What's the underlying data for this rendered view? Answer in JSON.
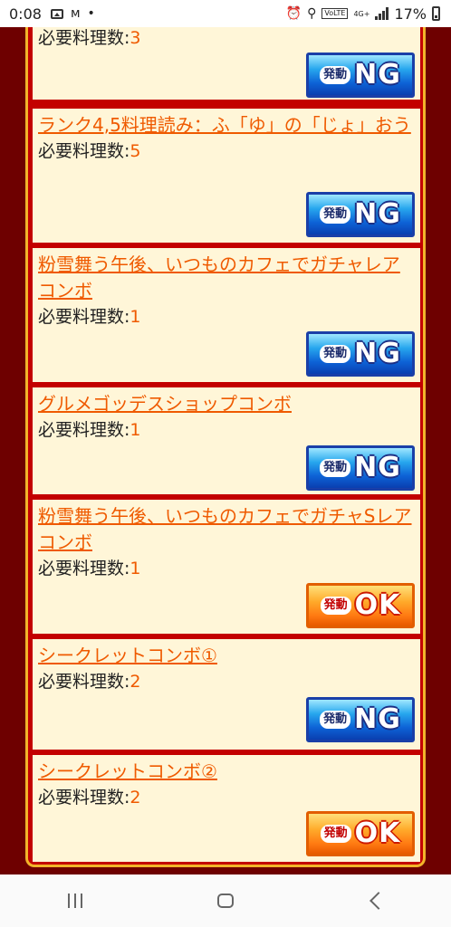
{
  "status_bar": {
    "time": "0:08",
    "network_label": "4G+",
    "volte_label": "VoLTE",
    "battery": "17%"
  },
  "nav": {
    "recent_label": "recent-apps",
    "home_label": "home",
    "back_label": "back"
  },
  "cards": [
    {
      "title": "",
      "req_label": "必要料理数:",
      "req_value": "3",
      "status": "NG"
    },
    {
      "title": "ランク4,5料理読み：ふ「ゆ」の「じょ」おう",
      "req_label": "必要料理数:",
      "req_value": "5",
      "status": "NG"
    },
    {
      "title": "粉雪舞う午後、いつものカフェでガチャレアコンボ",
      "req_label": "必要料理数:",
      "req_value": "1",
      "status": "NG"
    },
    {
      "title": "グルメゴッデスショップコンボ",
      "req_label": "必要料理数:",
      "req_value": "1",
      "status": "NG"
    },
    {
      "title": "粉雪舞う午後、いつものカフェでガチャSレアコンボ",
      "req_label": "必要料理数:",
      "req_value": "1",
      "status": "OK"
    },
    {
      "title": "シークレットコンボ①",
      "req_label": "必要料理数:",
      "req_value": "2",
      "status": "NG"
    },
    {
      "title": "シークレットコンボ②",
      "req_label": "必要料理数:",
      "req_value": "2",
      "status": "OK"
    }
  ],
  "badge_prefix": "発動",
  "colors": {
    "frame_dark": "#6e0000",
    "frame_red": "#c30000",
    "frame_gold": "#f2b42a",
    "card_bg": "#fff6d8",
    "link_orange": "#ef5a00",
    "ng_blue": "#0d62d6",
    "ok_orange": "#ff7a12"
  }
}
